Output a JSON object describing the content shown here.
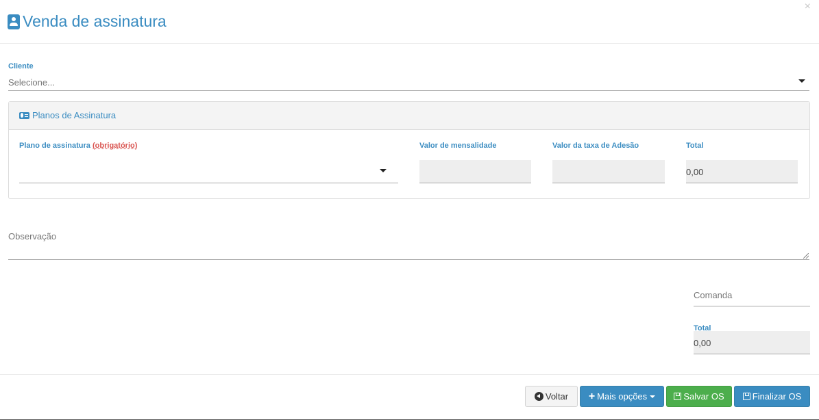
{
  "header": {
    "title": "Venda de assinatura",
    "title_icon": "user-badge-icon",
    "close_label": "×"
  },
  "cliente": {
    "label": "Cliente",
    "placeholder": "Selecione..."
  },
  "planos_panel": {
    "title": "Planos de Assinatura",
    "icon": "money-bill-icon",
    "plano_label": "Plano de assinatura",
    "plano_required": "(obrigatório)",
    "mensalidade_label": "Valor de mensalidade",
    "mensalidade_value": "",
    "adesao_label": "Valor da taxa de Adesão",
    "adesao_value": "",
    "total_label": "Total",
    "total_value": "0,00"
  },
  "observacao": {
    "placeholder": "Observação"
  },
  "comanda": {
    "placeholder": "Comanda"
  },
  "summary": {
    "total_label": "Total",
    "total_value": "0,00"
  },
  "footer": {
    "voltar_label": "Voltar",
    "mais_opcoes_label": "Mais opções",
    "salvar_label": "Salvar OS",
    "finalizar_label": "Finalizar OS"
  },
  "colors": {
    "primary": "#3a8cc1",
    "success": "#4cae4c",
    "required": "#d9534f"
  }
}
